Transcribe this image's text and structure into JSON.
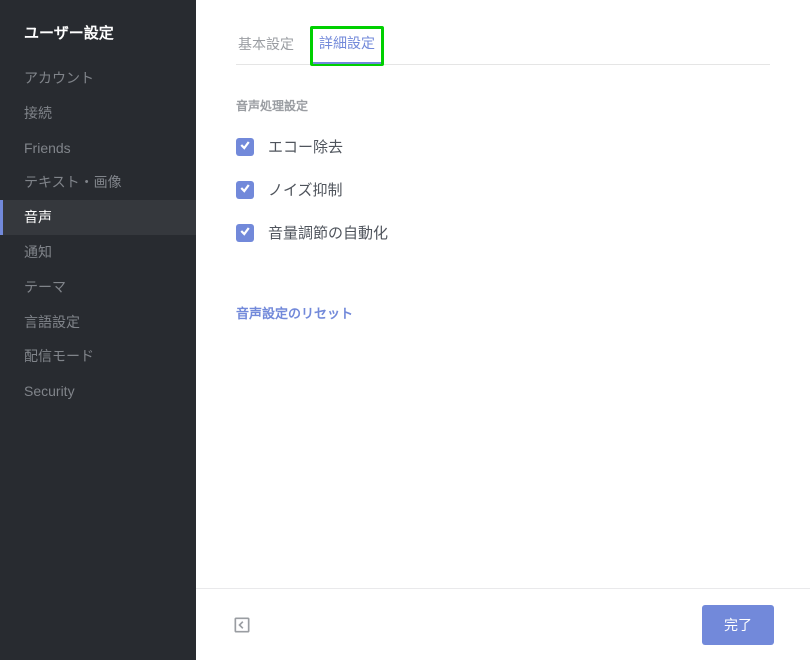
{
  "sidebar": {
    "title": "ユーザー設定",
    "items": [
      {
        "label": "アカウント",
        "active": false
      },
      {
        "label": "接続",
        "active": false
      },
      {
        "label": "Friends",
        "active": false
      },
      {
        "label": "テキスト・画像",
        "active": false
      },
      {
        "label": "音声",
        "active": true
      },
      {
        "label": "通知",
        "active": false
      },
      {
        "label": "テーマ",
        "active": false
      },
      {
        "label": "言語設定",
        "active": false
      },
      {
        "label": "配信モード",
        "active": false
      },
      {
        "label": "Security",
        "active": false
      }
    ]
  },
  "tabs": {
    "basic": "基本設定",
    "advanced": "詳細設定"
  },
  "section": {
    "heading": "音声処理設定"
  },
  "checks": {
    "echo": "エコー除去",
    "noise": "ノイズ抑制",
    "auto_gain": "音量調節の自動化"
  },
  "reset_link": "音声設定のリセット",
  "footer": {
    "done": "完了"
  }
}
